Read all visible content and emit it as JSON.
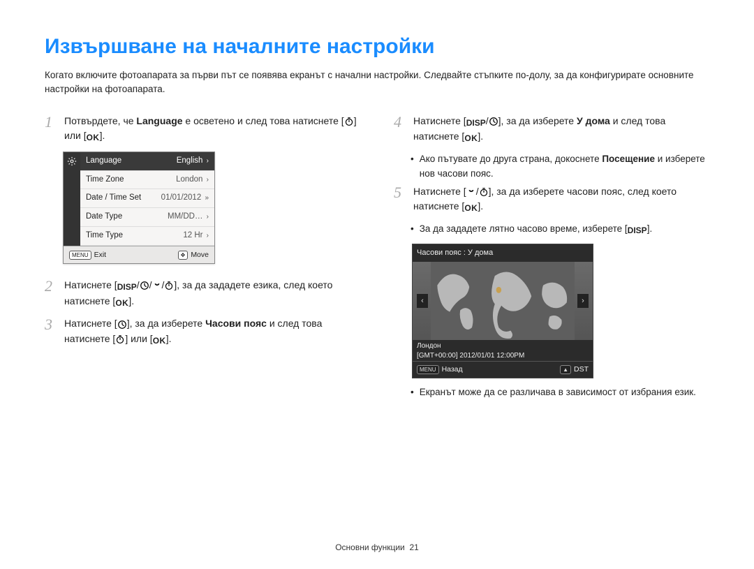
{
  "title": "Извършване на началните настройки",
  "intro": "Когато включите фотоапарата за първи път се появява екранът с начални настройки.  Следвайте стъпките по-долу, за да конфигурирате основните настройки на фотоапарата.",
  "labels": {
    "disp": "DISP",
    "ok": "OK",
    "menu": "MENU"
  },
  "step1": {
    "pre": "Потвърдете, че ",
    "bold": "Language",
    "mid": " е осветено и след това натиснете [",
    "end": "] или ["
  },
  "step2": {
    "pre": "Натиснете [",
    "mid": "], за да зададете езика, след което натиснете ["
  },
  "step3": {
    "pre": "Натиснете [",
    "mid1": "], за да изберете ",
    "bold": "Часови пояс",
    "mid2": " и след това натиснете [",
    "mid3": "] или ["
  },
  "step4": {
    "pre": "Натиснете [",
    "mid1": "], за да изберете ",
    "bold": "У дома",
    "mid2": " и след това натиснете ["
  },
  "step4_bullet": {
    "pre": "Ако пътувате до друга страна, докоснете ",
    "bold": "Посещение",
    "end": " и изберете нов часови пояс."
  },
  "step5": {
    "pre": "Натиснете [",
    "mid": "], за да изберете часови пояс, след което натиснете ["
  },
  "step5_bullet1": {
    "pre": "За да зададете лятно часово време, изберете ["
  },
  "step5_bullet2": "Екранът може да се различава в зависимост от избрания език.",
  "menu": {
    "rows": [
      {
        "label": "Language",
        "value": "English",
        "chev": "›",
        "selected": true
      },
      {
        "label": "Time Zone",
        "value": "London",
        "chev": "›",
        "selected": false
      },
      {
        "label": "Date / Time Set",
        "value": "01/01/2012",
        "chev": "»",
        "selected": false
      },
      {
        "label": "Date Type",
        "value": "MM/DD…",
        "chev": "›",
        "selected": false
      },
      {
        "label": "Time Type",
        "value": "12 Hr",
        "chev": "›",
        "selected": false
      }
    ],
    "footer_left": "Exit",
    "footer_right": "Move"
  },
  "map": {
    "title": "Часови пояс : У дома",
    "city": "Лондон",
    "gmt": "[GMT+00:00] 2012/01/01 12:00PM",
    "back": "Назад",
    "dst": "DST"
  },
  "footer": {
    "label": "Основни функции",
    "page": "21"
  }
}
